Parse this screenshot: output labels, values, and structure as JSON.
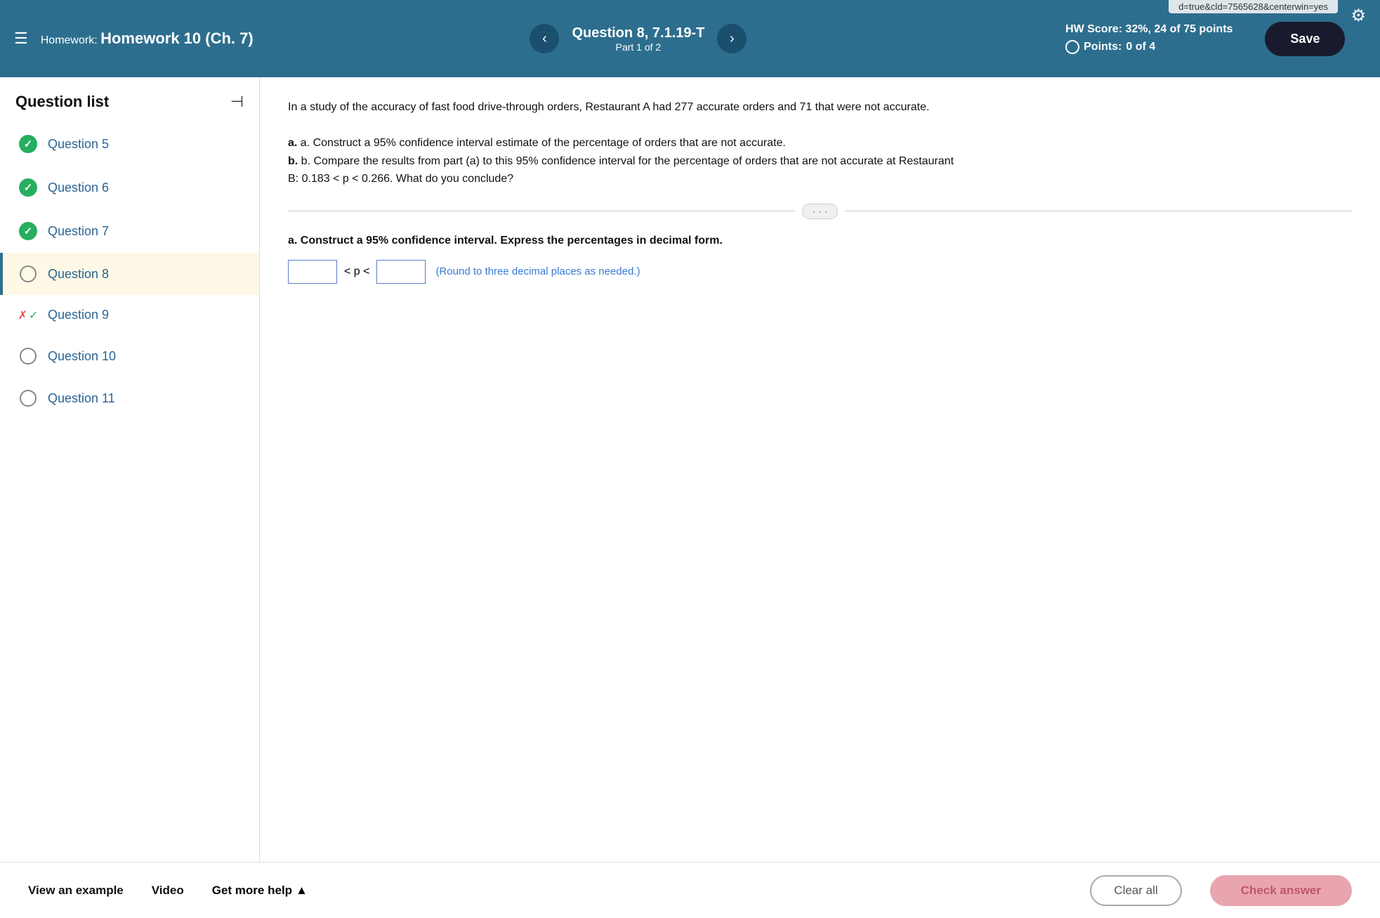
{
  "url_bar": "d=true&cld=7565628&centerwin=yes",
  "header": {
    "menu_icon": "☰",
    "homework_label": "Homework:",
    "homework_title": "Homework 10 (Ch. 7)",
    "nav_prev": "‹",
    "nav_next": "›",
    "question_title": "Question 8, 7.1.19-T",
    "question_part": "Part 1 of 2",
    "hw_score_label": "HW Score:",
    "hw_score_value": "32%, 24 of 75 points",
    "points_label": "Points:",
    "points_value": "0 of 4",
    "save_button": "Save",
    "gear_icon": "⚙"
  },
  "sidebar": {
    "title": "Question list",
    "collapse_icon": "⊣",
    "items": [
      {
        "id": "q5",
        "label": "Question 5",
        "status": "check"
      },
      {
        "id": "q6",
        "label": "Question 6",
        "status": "check"
      },
      {
        "id": "q7",
        "label": "Question 7",
        "status": "check"
      },
      {
        "id": "q8",
        "label": "Question 8",
        "status": "circle",
        "active": true
      },
      {
        "id": "q9",
        "label": "Question 9",
        "status": "partial"
      },
      {
        "id": "q10",
        "label": "Question 10",
        "status": "circle"
      },
      {
        "id": "q11",
        "label": "Question 11",
        "status": "circle"
      }
    ]
  },
  "content": {
    "question_intro": "In a study of the accuracy of fast food drive-through orders, Restaurant A had 277 accurate orders and 71 that were not accurate.",
    "part_a_instruction": "a. Construct a 95% confidence interval estimate of the percentage of orders that are not accurate.",
    "part_b_instruction": "b. Compare the results from part (a) to this 95% confidence interval for the percentage of orders that are not accurate at Restaurant B: 0.183 < p < 0.266. What do you conclude?",
    "divider_dots": "· · ·",
    "part_a_label": "a. Construct a 95% confidence interval. Express the percentages in decimal form.",
    "less_than_1": "< p <",
    "hint_text": "(Round to three decimal places as needed.)"
  },
  "footer": {
    "view_example": "View an example",
    "video": "Video",
    "get_more_help": "Get more help",
    "get_more_help_arrow": "▲",
    "clear_all": "Clear all",
    "check_answer": "Check answer"
  }
}
